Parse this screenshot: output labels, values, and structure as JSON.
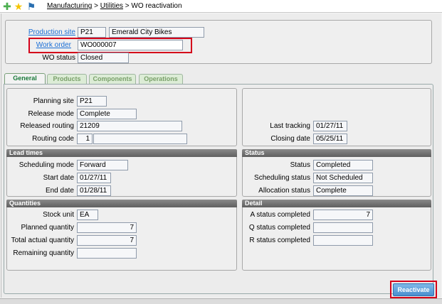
{
  "breadcrumb": {
    "item1": "Manufacturing",
    "sep1": ">",
    "item2": "Utilities",
    "sep2": ">",
    "current": "WO reactivation"
  },
  "toolbar": {
    "icons": [
      "add-favorite-icon",
      "favorites-star-icon",
      "signpost-icon"
    ]
  },
  "header": {
    "production_site_label": "Production site",
    "production_site_code": "P21",
    "production_site_name": "Emerald City Bikes",
    "work_order_label": "Work order",
    "work_order_value": "WO000007",
    "wo_status_label": "WO status",
    "wo_status_value": "Closed"
  },
  "tabs": [
    "General",
    "Products",
    "Components",
    "Operations"
  ],
  "general": {
    "planning_site_label": "Planning site",
    "planning_site": "P21",
    "release_mode_label": "Release mode",
    "release_mode": "Complete",
    "released_routing_label": "Released routing",
    "released_routing": "21209",
    "routing_code_label": "Routing code",
    "routing_code": "1",
    "last_tracking_label": "Last tracking",
    "last_tracking": "01/27/11",
    "closing_date_label": "Closing date",
    "closing_date": "05/25/11"
  },
  "lead_times": {
    "title": "Lead times",
    "scheduling_mode_label": "Scheduling mode",
    "scheduling_mode": "Forward",
    "start_date_label": "Start date",
    "start_date": "01/27/11",
    "end_date_label": "End date",
    "end_date": "01/28/11"
  },
  "status": {
    "title": "Status",
    "status_label": "Status",
    "status": "Completed",
    "scheduling_status_label": "Scheduling status",
    "scheduling_status": "Not Scheduled",
    "allocation_status_label": "Allocation status",
    "allocation_status": "Complete"
  },
  "quantities": {
    "title": "Quantities",
    "stock_unit_label": "Stock unit",
    "stock_unit": "EA",
    "planned_quantity_label": "Planned quantity",
    "planned_quantity": "7",
    "total_actual_quantity_label": "Total actual quantity",
    "total_actual_quantity": "7",
    "remaining_quantity_label": "Remaining quantity",
    "remaining_quantity": ""
  },
  "detail": {
    "title": "Detail",
    "a_status_label": "A status completed",
    "a_status": "7",
    "q_status_label": "Q status completed",
    "q_status": "",
    "r_status_label": "R status completed",
    "r_status": ""
  },
  "actions": {
    "reactivate_label": "Reactivate"
  },
  "colors": {
    "link": "#1a6fd6",
    "highlight": "#d4001a",
    "button": "#4a8fcf"
  }
}
